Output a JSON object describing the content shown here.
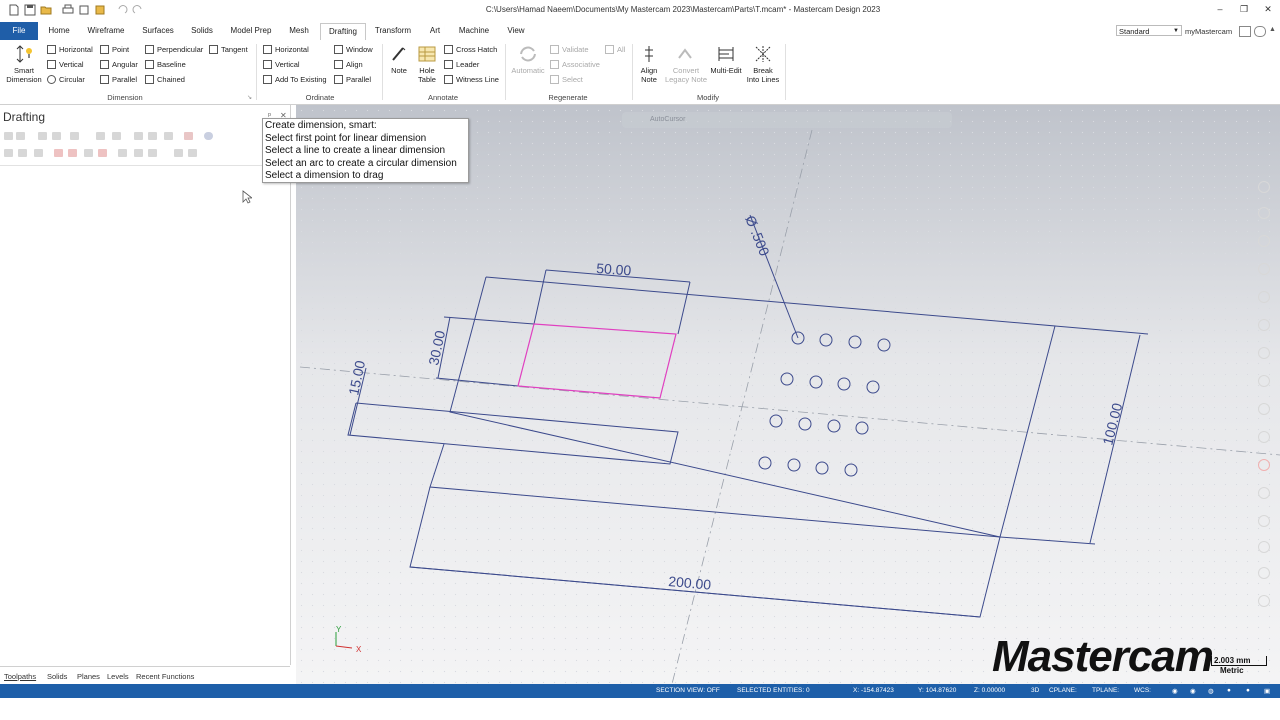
{
  "window": {
    "title": "C:\\Users\\Hamad Naeem\\Documents\\My Mastercam 2023\\Mastercam\\Parts\\T.mcam* - Mastercam Design 2023",
    "workspace": "Standard",
    "my_mastercam": "myMastercam"
  },
  "tabs": [
    "File",
    "Home",
    "Wireframe",
    "Surfaces",
    "Solids",
    "Model Prep",
    "Mesh",
    "Drafting",
    "Transform",
    "Art",
    "Machine",
    "View"
  ],
  "active_tab": "Drafting",
  "ribbon": {
    "dimension": {
      "label": "Dimension",
      "smart": "Smart\nDimension",
      "horizontal": "Horizontal",
      "vertical": "Vertical",
      "circular": "Circular",
      "point": "Point",
      "angular": "Angular",
      "parallel": "Parallel",
      "perpendicular": "Perpendicular",
      "tangent": "Tangent",
      "baseline": "Baseline",
      "chained": "Chained"
    },
    "ordinate": {
      "label": "Ordinate",
      "horizontal": "Horizontal",
      "vertical": "Vertical",
      "add_to_existing": "Add To Existing",
      "window": "Window",
      "align": "Align",
      "parallel": "Parallel"
    },
    "annotate": {
      "label": "Annotate",
      "note": "Note",
      "hole_table": "Hole\nTable",
      "cross_hatch": "Cross Hatch",
      "leader": "Leader",
      "witness_line": "Witness Line"
    },
    "regenerate": {
      "label": "Regenerate",
      "automatic": "Automatic",
      "validate": "Validate",
      "all": "All",
      "associative": "Associative",
      "select": "Select"
    },
    "modify": {
      "label": "Modify",
      "align_note": "Align\nNote",
      "convert_legacy": "Convert\nLegacy Note",
      "multi_edit": "Multi-Edit",
      "break_into_lines": "Break\nInto Lines"
    }
  },
  "panel": {
    "title": "Drafting"
  },
  "tooltip": [
    "Create dimension, smart:",
    "Select first point for linear dimension",
    "Select a line to create a linear dimension",
    "Select an arc to create a circular dimension",
    "Select a dimension to drag"
  ],
  "viewport": {
    "autocursor": "AutoCursor",
    "dims": {
      "top": "50.00",
      "left_height": "30.00",
      "left_small": "15.00",
      "diameter": "Ø .500",
      "right": "100.00",
      "bottom": "200.00"
    },
    "axes": {
      "x": "X",
      "y": "Y"
    }
  },
  "bottom_tabs": [
    "Toolpaths",
    "Solids",
    "Planes",
    "Levels",
    "Recent Functions"
  ],
  "status": {
    "section_view": "SECTION VIEW: OFF",
    "selected": "SELECTED ENTITIES: 0",
    "x": "X:  -154.87423",
    "y": "Y:  104.87620",
    "z": "Z:  0.00000",
    "mode": "3D",
    "cplane": "CPLANE:",
    "tplane": "TPLANE:",
    "wcs": "WCS:"
  },
  "logo": "Mastercam",
  "scale": {
    "value": "2.003 mm",
    "unit": "Metric"
  },
  "colors": {
    "file_tab": "#1f5ea8",
    "status_bar": "#1e5fa9",
    "geometry": "#3c4a8c",
    "selection": "#e040c0"
  }
}
